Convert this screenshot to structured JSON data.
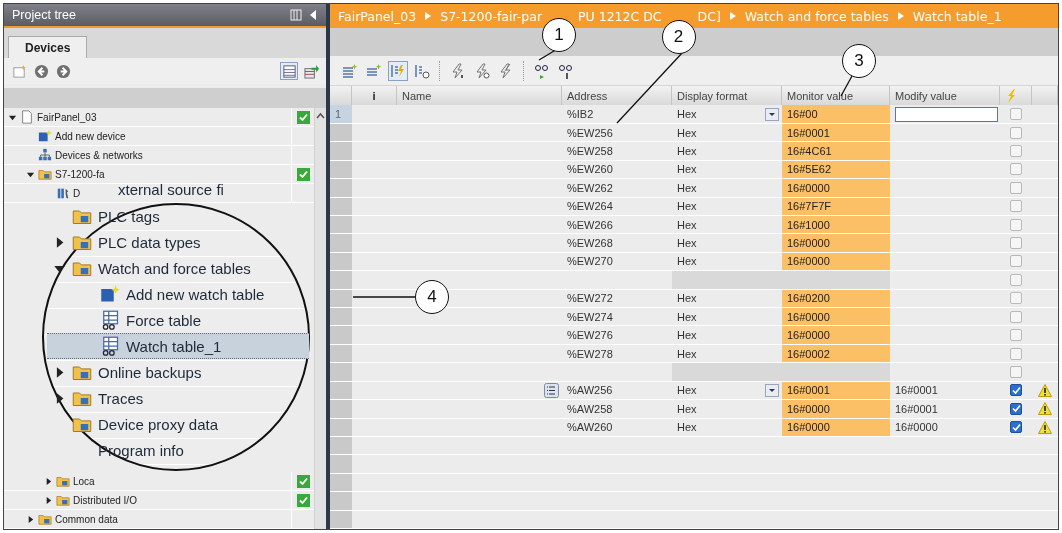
{
  "project_tree": {
    "title": "Project tree",
    "tabs": [
      {
        "label": "Devices",
        "selected": true
      }
    ],
    "toolbar_buttons": [
      {
        "pressed": false
      },
      {
        "pressed": false
      },
      {
        "pressed": false
      },
      {
        "pressed": true
      },
      {
        "pressed": false
      }
    ],
    "items": [
      {
        "text": "FairPanel_03",
        "kind": "document",
        "expanded": true,
        "status_ok": true,
        "children": [
          {
            "text": "Add new device",
            "kind": "add"
          },
          {
            "text": "Devices & networks",
            "kind": "network"
          },
          {
            "text": "S7-1200-fa",
            "kind": "folder",
            "expanded": true,
            "status_ok": true,
            "children": [
              {
                "text": "D",
                "kind": "config"
              },
              {
                "text": "Loca",
                "kind": "folder",
                "expanded": false,
                "status_ok": true
              },
              {
                "text": "Distributed I/O",
                "kind": "folder",
                "expanded": false,
                "status_ok": true
              }
            ]
          },
          {
            "text": "Common data",
            "kind": "folder",
            "expanded": false
          }
        ]
      }
    ]
  },
  "magnifier": {
    "items": [
      {
        "text": "xternal source fi",
        "kind": "text",
        "selected": false,
        "children": [
          {
            "text": "PLC tags",
            "kind": "folder",
            "selected": false
          },
          {
            "text": "PLC data types",
            "kind": "folder",
            "expanded": false,
            "selected": false
          },
          {
            "text": "Watch and force tables",
            "kind": "folder",
            "expanded": true,
            "selected": false,
            "children": [
              {
                "text": "Add new watch table",
                "kind": "add",
                "selected": false
              },
              {
                "text": "Force table",
                "kind": "table",
                "selected": false
              },
              {
                "text": "Watch table_1",
                "kind": "table",
                "selected": true
              }
            ]
          },
          {
            "text": "Online backups",
            "kind": "folder",
            "expanded": false,
            "selected": false
          },
          {
            "text": "Traces",
            "kind": "folder",
            "expanded": false,
            "selected": false
          },
          {
            "text": "Device proxy data",
            "kind": "folder",
            "selected": false
          },
          {
            "text": "Program info",
            "kind": "text",
            "selected": false
          }
        ]
      }
    ]
  },
  "breadcrumb": [
    {
      "fragments": [
        "FairPanel_03"
      ]
    },
    {
      "fragments": [
        "S7-1200-fair-par",
        "PU 1212C DC",
        "DC]"
      ]
    },
    {
      "fragments": [
        "Watch and force tables"
      ]
    },
    {
      "fragments": [
        "Watch table_1"
      ]
    }
  ],
  "toolbar_buttons": [
    {
      "pressed": false
    },
    {
      "pressed": false
    },
    {
      "pressed": true
    },
    {
      "pressed": false
    },
    {
      "pressed": false
    },
    {
      "pressed": false
    },
    {
      "pressed": false
    },
    {
      "pressed": false
    },
    {
      "pressed": false
    }
  ],
  "watch_table": {
    "columns": [
      "i",
      "Name",
      "Address",
      "Display format",
      "Monitor value",
      "Modify value"
    ],
    "rows": [
      {
        "kind": "entry",
        "selected": true,
        "number": "1",
        "address": "%IB2",
        "display_format": "Hex",
        "monitor_value": "16#00",
        "dropdown": true,
        "editing": true,
        "list_icon": false,
        "force": false,
        "warning": false
      },
      {
        "kind": "entry",
        "selected": false,
        "address": "%EW256",
        "display_format": "Hex",
        "monitor_value": "16#0001",
        "dropdown": false,
        "editing": false,
        "list_icon": false,
        "force": false,
        "warning": false
      },
      {
        "kind": "entry",
        "selected": false,
        "address": "%EW258",
        "display_format": "Hex",
        "monitor_value": "16#4C61",
        "dropdown": false,
        "editing": false,
        "list_icon": false,
        "force": false,
        "warning": false
      },
      {
        "kind": "entry",
        "selected": false,
        "address": "%EW260",
        "display_format": "Hex",
        "monitor_value": "16#5E62",
        "dropdown": false,
        "editing": false,
        "list_icon": false,
        "force": false,
        "warning": false
      },
      {
        "kind": "entry",
        "selected": false,
        "address": "%EW262",
        "display_format": "Hex",
        "monitor_value": "16#0000",
        "dropdown": false,
        "editing": false,
        "list_icon": false,
        "force": false,
        "warning": false
      },
      {
        "kind": "entry",
        "selected": false,
        "address": "%EW264",
        "display_format": "Hex",
        "monitor_value": "16#7F7F",
        "dropdown": false,
        "editing": false,
        "list_icon": false,
        "force": false,
        "warning": false
      },
      {
        "kind": "entry",
        "selected": false,
        "address": "%EW266",
        "display_format": "Hex",
        "monitor_value": "16#1000",
        "dropdown": false,
        "editing": false,
        "list_icon": false,
        "force": false,
        "warning": false
      },
      {
        "kind": "entry",
        "selected": false,
        "address": "%EW268",
        "display_format": "Hex",
        "monitor_value": "16#0000",
        "dropdown": false,
        "editing": false,
        "list_icon": false,
        "force": false,
        "warning": false
      },
      {
        "kind": "entry",
        "selected": false,
        "address": "%EW270",
        "display_format": "Hex",
        "monitor_value": "16#0000",
        "dropdown": false,
        "editing": false,
        "list_icon": false,
        "force": false,
        "warning": false
      },
      {
        "kind": "separator",
        "selected": false,
        "force": false
      },
      {
        "kind": "entry",
        "selected": false,
        "address": "%EW272",
        "display_format": "Hex",
        "monitor_value": "16#0200",
        "dropdown": false,
        "editing": false,
        "list_icon": false,
        "force": false,
        "warning": false
      },
      {
        "kind": "entry",
        "selected": false,
        "address": "%EW274",
        "display_format": "Hex",
        "monitor_value": "16#0000",
        "dropdown": false,
        "editing": false,
        "list_icon": false,
        "force": false,
        "warning": false
      },
      {
        "kind": "entry",
        "selected": false,
        "address": "%EW276",
        "display_format": "Hex",
        "monitor_value": "16#0000",
        "dropdown": false,
        "editing": false,
        "list_icon": false,
        "force": false,
        "warning": false
      },
      {
        "kind": "entry",
        "selected": false,
        "address": "%EW278",
        "display_format": "Hex",
        "monitor_value": "16#0002",
        "dropdown": false,
        "editing": false,
        "list_icon": false,
        "force": false,
        "warning": false
      },
      {
        "kind": "separator",
        "selected": false,
        "force": false
      },
      {
        "kind": "entry",
        "selected": false,
        "address": "%AW256",
        "display_format": "Hex",
        "monitor_value": "16#0001",
        "modify_value": "16#0001",
        "dropdown": true,
        "editing": false,
        "list_icon": true,
        "force": true,
        "warning": true
      },
      {
        "kind": "entry",
        "selected": false,
        "address": "%AW258",
        "display_format": "Hex",
        "monitor_value": "16#0000",
        "modify_value": "16#0001",
        "dropdown": false,
        "editing": false,
        "list_icon": false,
        "force": true,
        "warning": true
      },
      {
        "kind": "entry",
        "selected": false,
        "address": "%AW260",
        "display_format": "Hex",
        "monitor_value": "16#0000",
        "modify_value": "16#0000",
        "dropdown": false,
        "editing": false,
        "list_icon": false,
        "force": true,
        "warning": true
      }
    ]
  },
  "callouts": [
    {
      "number": "1"
    },
    {
      "number": "2"
    },
    {
      "number": "3"
    },
    {
      "number": "4"
    }
  ]
}
